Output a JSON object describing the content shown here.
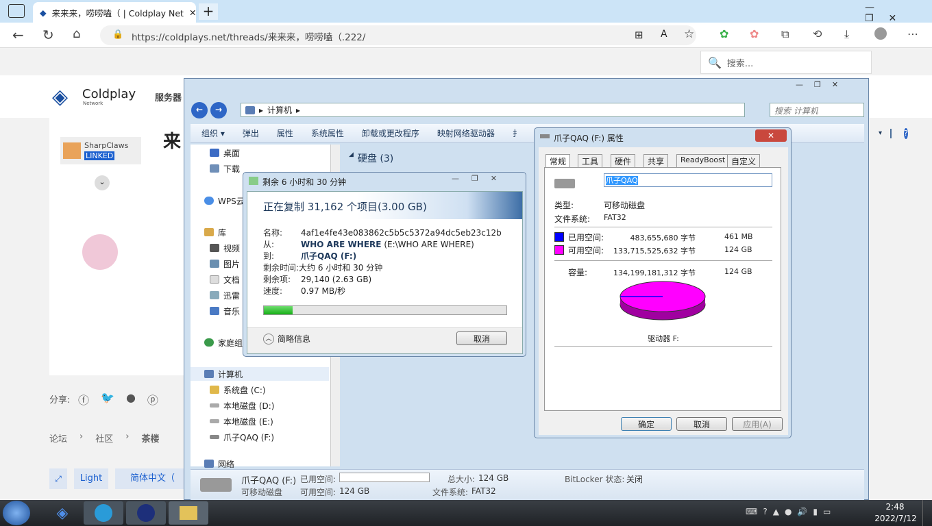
{
  "browser": {
    "tab_title": "来来来，唠唠嗑（ | Coldplay Net",
    "url": "https://coldplays.net/threads/来来来，唠唠嗑（.222/",
    "search_placeholder": "搜索..."
  },
  "site": {
    "logo_text": "Coldplay",
    "logo_sub": "Network",
    "nav_item": "服务器",
    "thread_title": "来",
    "user_name": "SharpClaws",
    "user_badge": "LINKED",
    "share_label": "分享:",
    "breadcrumb": [
      "论坛",
      "社区",
      "茶楼"
    ],
    "footer_style": "Light",
    "footer_lang": "简体中文（"
  },
  "explorer": {
    "path": "计算机",
    "search_placeholder": "搜索 计算机",
    "toolbar": [
      "组织 ▾",
      "弹出",
      "属性",
      "系统属性",
      "卸载或更改程序",
      "映射网络驱动器",
      "扌"
    ],
    "section_title": "硬盘 (3)",
    "nav": {
      "desktop": "桌面",
      "downloads": "下载",
      "wps": "WPS云",
      "library": "库",
      "video": "视频",
      "pictures": "图片",
      "docs": "文档",
      "thunder": "迅雷",
      "music": "音乐",
      "homegroup": "家庭组",
      "computer": "计算机",
      "drive_c": "系统盘 (C:)",
      "drive_d": "本地磁盘 (D:)",
      "drive_e": "本地磁盘 (E:)",
      "drive_f": "爪子QAQ (F:)",
      "network": "网络"
    },
    "details": {
      "name": "爪子QAQ (F:)",
      "type": "可移动磁盘",
      "used_label": "已用空间:",
      "free_label": "可用空间:",
      "free_value": "124 GB",
      "total_label": "总大小:",
      "total_value": "124 GB",
      "fs_label": "文件系统:",
      "fs_value": "FAT32",
      "bitlocker_label": "BitLocker 状态:",
      "bitlocker_value": "关闭"
    }
  },
  "copy_dialog": {
    "title": "剩余 6 小时和 30 分钟",
    "heading": "正在复制 31,162 个项目(3.00 GB)",
    "rows": [
      {
        "label": "名称:",
        "value": "4af1e4fe43e083862c5b5c5372a94dc5eb23c12b"
      },
      {
        "label": "从:",
        "value": "WHO ARE WHERE",
        "extra": "(E:\\WHO ARE WHERE)"
      },
      {
        "label": "到:",
        "value": "爪子QAQ (F:)"
      },
      {
        "label": "剩余时间:",
        "value": "大约 6 小时和 30 分钟"
      },
      {
        "label": "剩余项:",
        "value": "29,140 (2.63 GB)"
      },
      {
        "label": "速度:",
        "value": "0.97 MB/秒"
      }
    ],
    "progress": 0.12,
    "less_info": "简略信息",
    "cancel": "取消"
  },
  "props_dialog": {
    "title": "爪子QAQ (F:) 属性",
    "tabs": [
      "常规",
      "工具",
      "硬件",
      "共享",
      "ReadyBoost",
      "自定义"
    ],
    "volume_name": "爪子QAQ",
    "type_label": "类型:",
    "type_value": "可移动磁盘",
    "fs_label": "文件系统:",
    "fs_value": "FAT32",
    "used_label": "已用空间:",
    "used_bytes": "483,655,680 字节",
    "used_size": "461 MB",
    "free_label": "可用空间:",
    "free_bytes": "133,715,525,632 字节",
    "free_size": "124 GB",
    "cap_label": "容量:",
    "cap_bytes": "134,199,181,312 字节",
    "cap_size": "124 GB",
    "drive_label": "驱动器 F:",
    "ok": "确定",
    "cancel": "取消",
    "apply": "应用(A)",
    "colors": {
      "used": "#0000ff",
      "free": "#ff00ff"
    }
  },
  "taskbar": {
    "time": "2:48",
    "date": "2022/7/12"
  }
}
